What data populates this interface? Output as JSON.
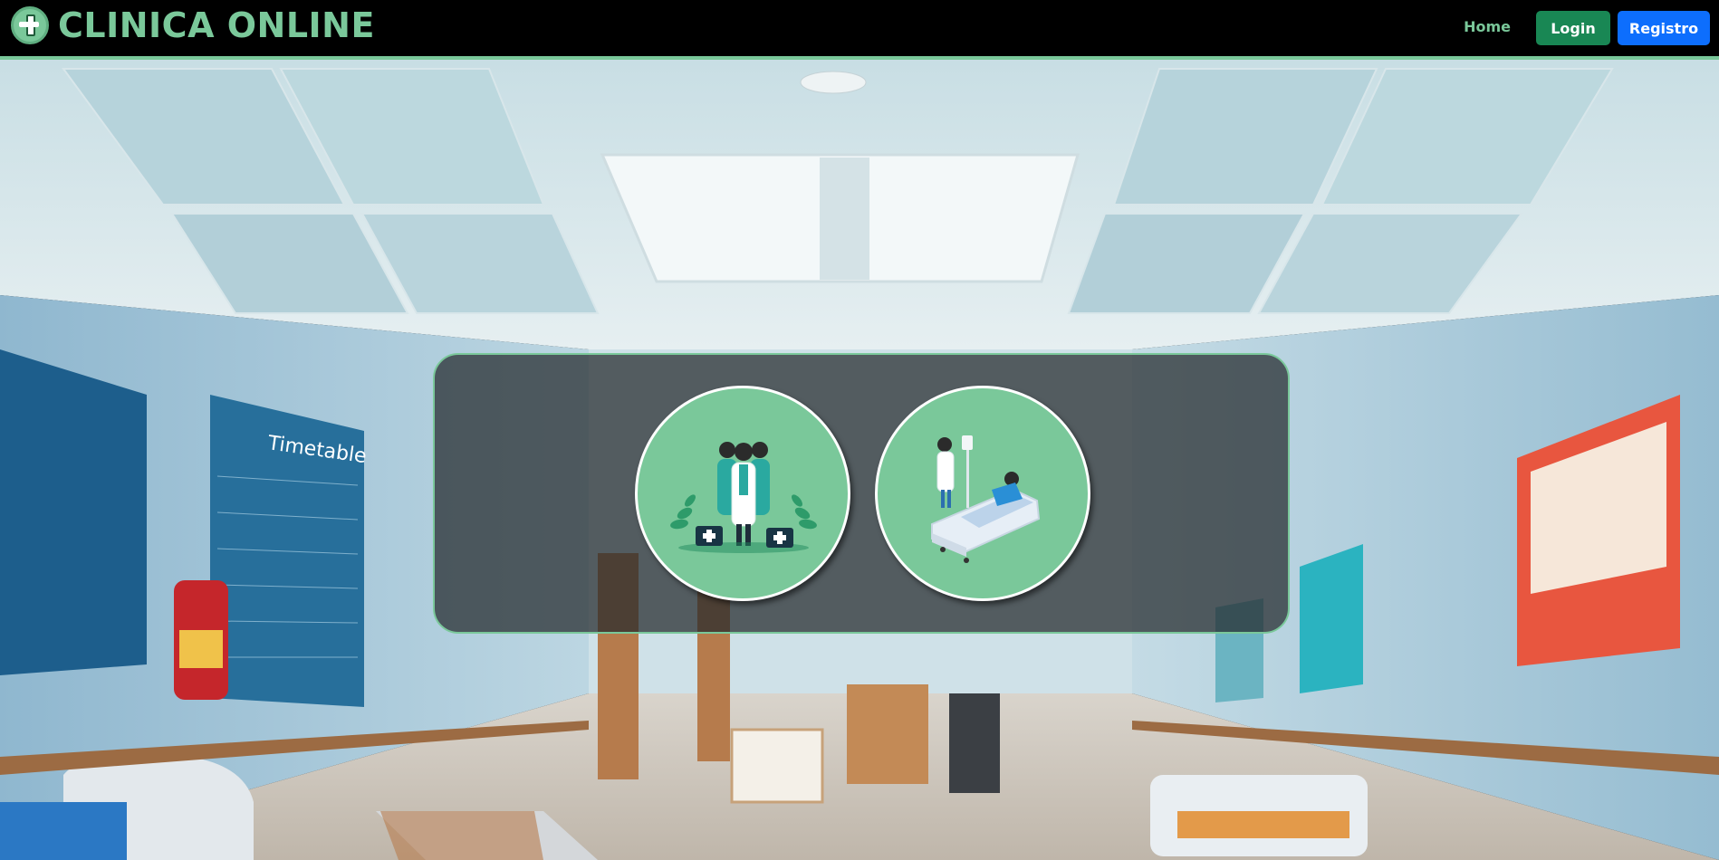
{
  "header": {
    "brand_title": "CLINICA ONLINE",
    "logo_icon": "medical-cross-icon",
    "nav": {
      "home_label": "Home",
      "login_label": "Login",
      "register_label": "Registro"
    }
  },
  "colors": {
    "accent_green": "#7ac89a",
    "login_button": "#198754",
    "register_button": "#0d6efd",
    "navbar_bg": "#000000"
  },
  "background": {
    "poster_label": "Timetable"
  },
  "selection_panel": {
    "options": [
      {
        "icon": "doctors-team-icon"
      },
      {
        "icon": "patient-bed-icon"
      }
    ]
  }
}
